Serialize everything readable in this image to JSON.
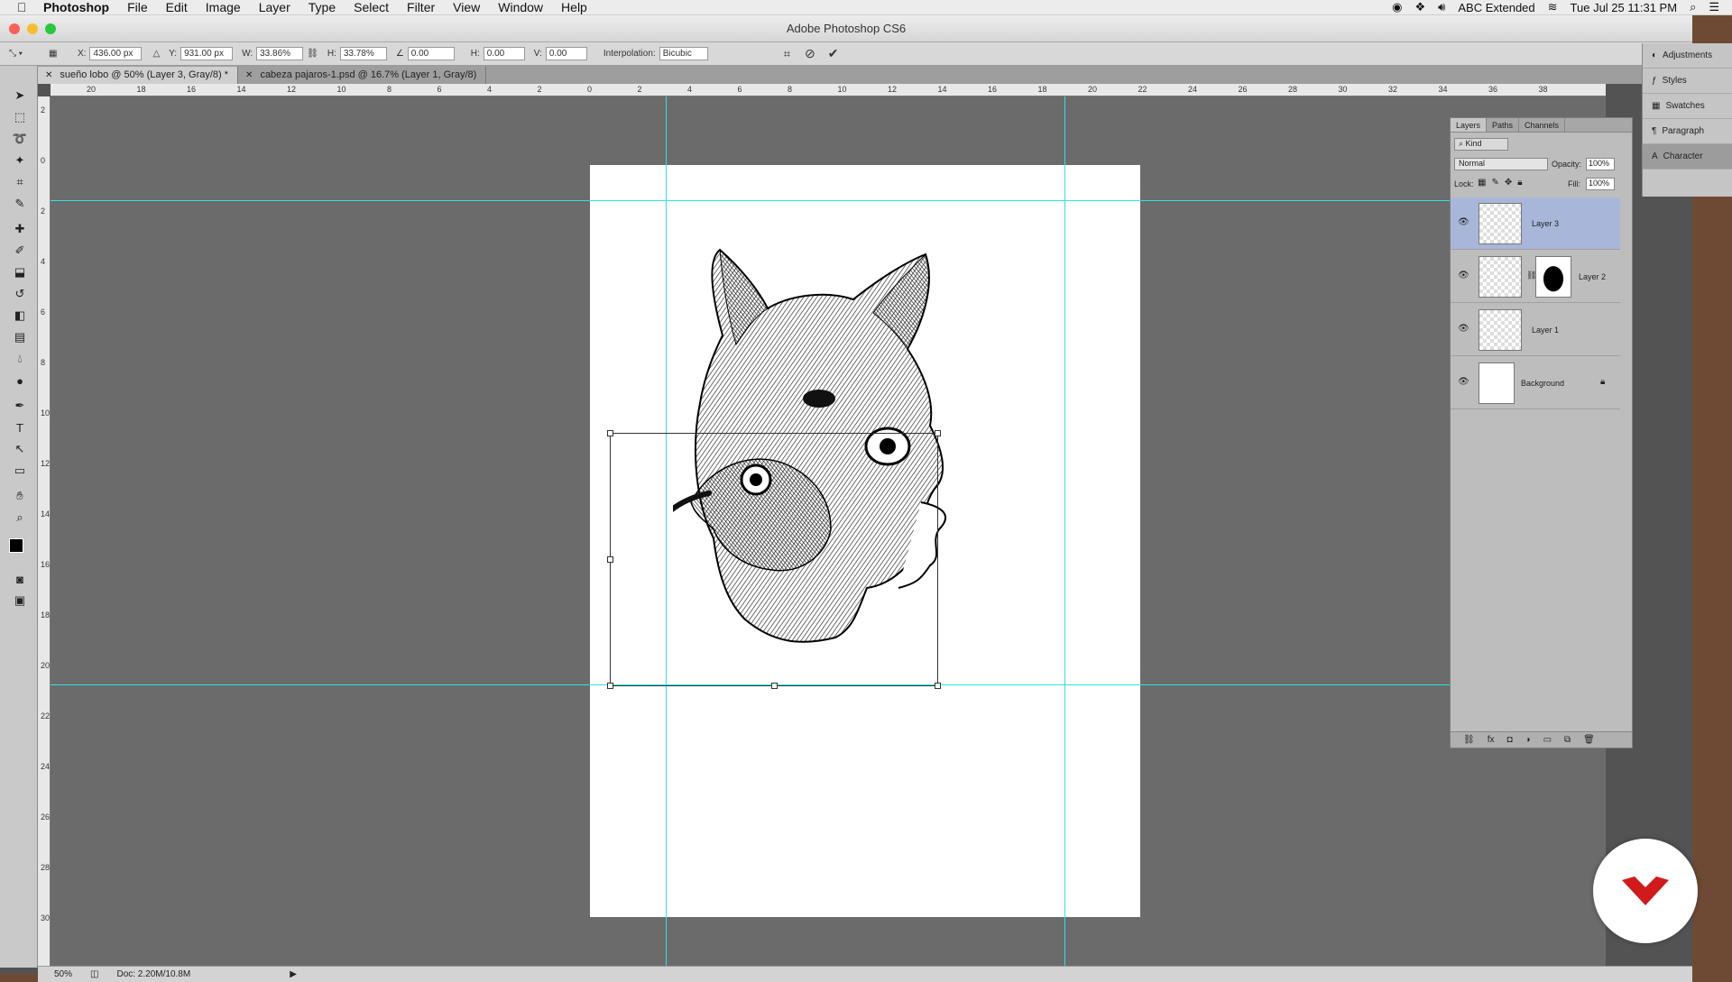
{
  "menubar": {
    "app": "Photoshop",
    "items": [
      "File",
      "Edit",
      "Image",
      "Layer",
      "Type",
      "Select",
      "Filter",
      "View",
      "Window",
      "Help"
    ],
    "input_source": "ABC Extended",
    "clock": "Tue Jul 25  11:31 PM"
  },
  "window": {
    "title": "Adobe Photoshop CS6"
  },
  "options": {
    "x": "436.00 px",
    "y": "931.00 px",
    "w": "33.86%",
    "h": "33.78%",
    "angle": "0.00",
    "h_skew": "0.00",
    "v_skew": "0.00",
    "interp_label": "Interpolation:",
    "interp": "Bicubic",
    "x_label": "X:",
    "y_label": "Y:",
    "w_label": "W:",
    "h_label": "H:",
    "hs_label": "H:",
    "vs_label": "V:"
  },
  "tabs": [
    {
      "label": "sueño lobo @ 50% (Layer 3, Gray/8) *",
      "active": true
    },
    {
      "label": "cabeza pajaros-1.psd @ 16.7% (Layer 1, Gray/8)",
      "active": false
    }
  ],
  "hruler": [
    "20",
    "18",
    "16",
    "14",
    "12",
    "10",
    "8",
    "6",
    "4",
    "2",
    "0",
    "2",
    "4",
    "6",
    "8",
    "10",
    "12",
    "14",
    "16",
    "18",
    "20",
    "22",
    "24",
    "26",
    "28",
    "30",
    "32",
    "34",
    "36",
    "38"
  ],
  "vruler": [
    "2",
    "0",
    "2",
    "4",
    "6",
    "8",
    "10",
    "12",
    "14",
    "16",
    "18",
    "20",
    "22",
    "24",
    "26",
    "28",
    "30"
  ],
  "status": {
    "zoom": "50%",
    "doc": "Doc: 2.20M/10.8M"
  },
  "layers_panel": {
    "tabs": [
      "Layers",
      "Paths",
      "Channels"
    ],
    "kind": "Kind",
    "blend": "Normal",
    "opacity_label": "Opacity:",
    "opacity": "100%",
    "lock_label": "Lock:",
    "fill_label": "Fill:",
    "fill": "100%",
    "layers": [
      {
        "name": "Layer 3",
        "selected": true
      },
      {
        "name": "Layer 2",
        "selected": false
      },
      {
        "name": "Layer 1",
        "selected": false
      },
      {
        "name": "Background",
        "selected": false
      }
    ]
  },
  "dock": [
    "Adjustments",
    "Styles",
    "Swatches",
    "Paragraph",
    "Character"
  ],
  "colors": {
    "guide": "#2fe3e3",
    "selected_layer": "#a8b7d9",
    "logo": "#d11b1b"
  }
}
